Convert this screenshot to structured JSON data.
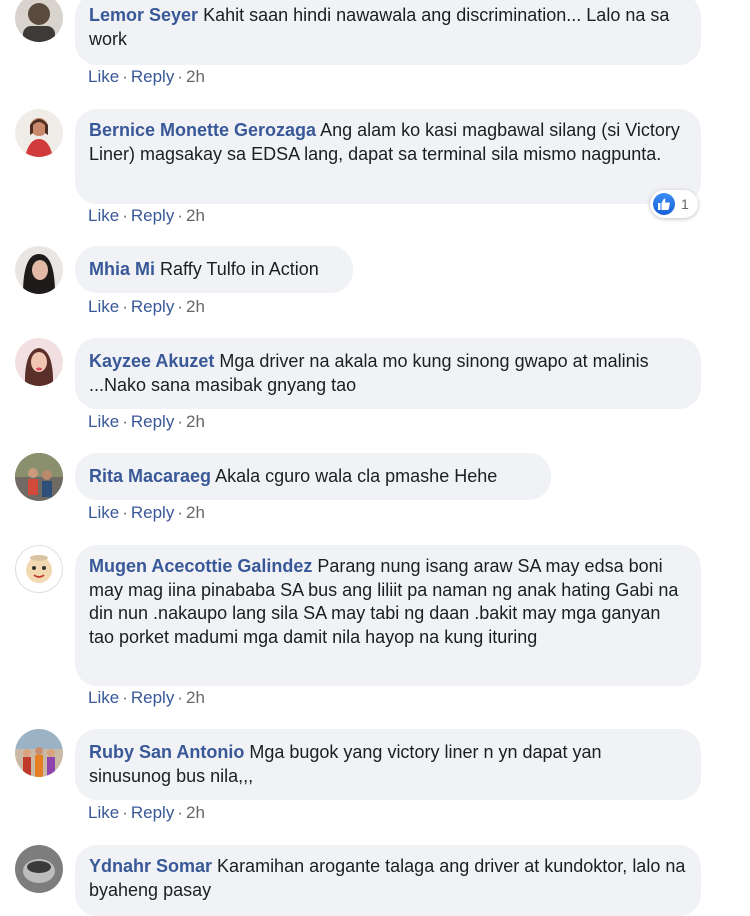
{
  "actions": {
    "like": "Like",
    "reply": "Reply",
    "separator": "·"
  },
  "comments": [
    {
      "name": "Lemor Seyer",
      "text": "Kahit saan hindi nawawala ang discrimination... Lalo na sa work",
      "time": "2h"
    },
    {
      "name": "Bernice Monette Gerozaga",
      "text": "Ang alam ko kasi magbawal silang (si Victory Liner) magsakay sa EDSA lang, dapat sa terminal sila mismo nagpunta.",
      "time": "2h",
      "reaction_count": "1"
    },
    {
      "name": "Mhia Mi",
      "text": "Raffy Tulfo in Action",
      "time": "2h"
    },
    {
      "name": "Kayzee Akuzet",
      "text": "Mga driver na akala mo kung sinong gwapo at malinis ...Nako sana masibak gnyang tao",
      "time": "2h"
    },
    {
      "name": "Rita Macaraeg",
      "text": "Akala cguro wala cla pmashe Hehe",
      "time": "2h"
    },
    {
      "name": "Mugen Acecottie Galindez",
      "text": "Parang nung isang araw SA may edsa boni may mag iina pinababa SA bus ang liliit pa naman ng anak hating Gabi na din nun .nakaupo lang sila SA may tabi ng daan .bakit may mga ganyan tao porket madumi mga damit nila hayop na kung ituring",
      "time": "2h"
    },
    {
      "name": "Ruby San Antonio",
      "text": "Mga bugok yang victory liner n yn dapat yan sinusunog bus nila,,,",
      "time": "2h"
    },
    {
      "name": "Ydnahr Somar",
      "text": "Karamihan arogante talaga ang driver at kundoktor, lalo na byaheng pasay",
      "time": ""
    }
  ]
}
